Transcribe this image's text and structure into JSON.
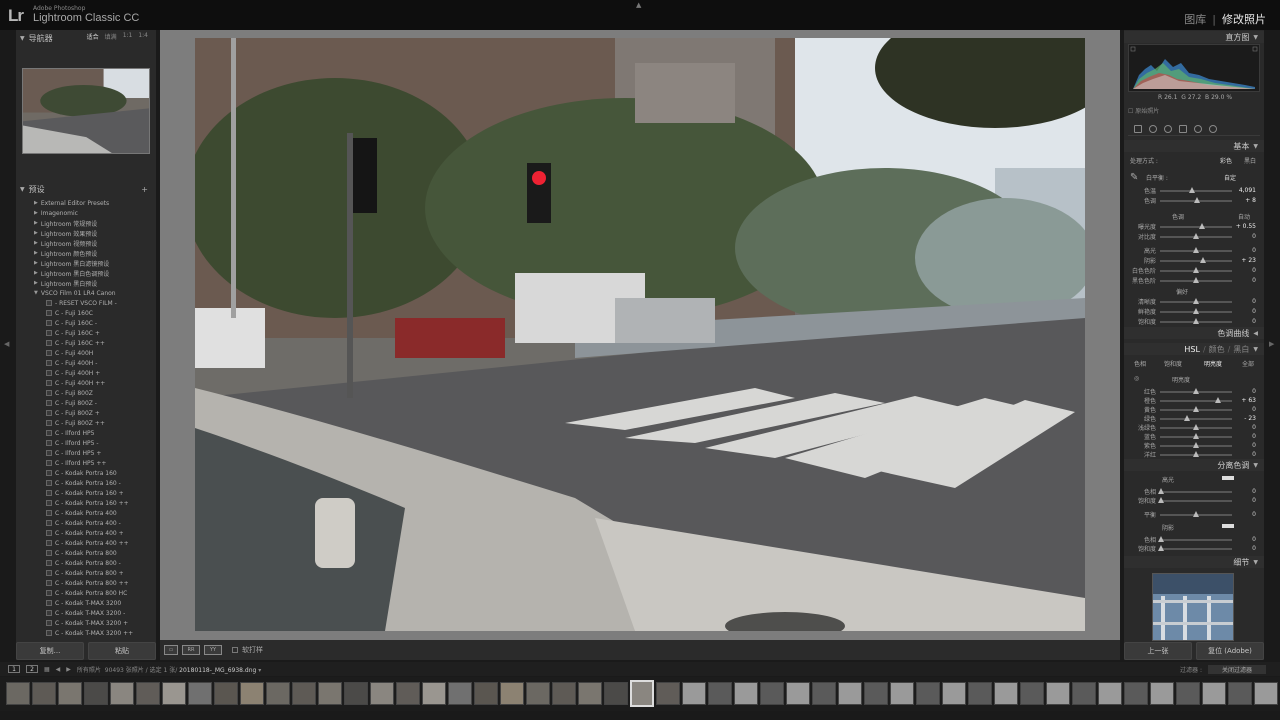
{
  "app": {
    "logo": "Lr",
    "brand_small": "Adobe Photoshop",
    "brand": "Lightroom Classic CC",
    "modules": [
      "图库",
      "修改照片"
    ],
    "active_module": "修改照片"
  },
  "left": {
    "navigator": {
      "title": "导航器",
      "zoom": [
        "适合",
        "填满",
        "1:1",
        "1:4"
      ]
    },
    "presets": {
      "title": "预设",
      "add": "+",
      "folders": [
        "External Editor Presets",
        "Imagenomic",
        "Lightroom 常规预设",
        "Lightroom 效果预设",
        "Lightroom 视频预设",
        "Lightroom 颜色预设",
        "Lightroom 黑白滤镜预设",
        "Lightroom 黑白色调预设",
        "Lightroom 黑白预设"
      ],
      "open_folder": "VSCO Film 01 LR4 Canon",
      "items": [
        "- RESET VSCO FILM -",
        "C - Fuji 160C",
        "C - Fuji 160C -",
        "C - Fuji 160C +",
        "C - Fuji 160C ++",
        "C - Fuji 400H",
        "C - Fuji 400H -",
        "C - Fuji 400H +",
        "C - Fuji 400H ++",
        "C - Fuji 800Z",
        "C - Fuji 800Z -",
        "C - Fuji 800Z +",
        "C - Fuji 800Z ++",
        "C - Ilford HP5",
        "C - Ilford HP5 -",
        "C - Ilford HP5 +",
        "C - Ilford HP5 ++",
        "C - Kodak Portra 160",
        "C - Kodak Portra 160 -",
        "C - Kodak Portra 160 +",
        "C - Kodak Portra 160 ++",
        "C - Kodak Portra 400",
        "C - Kodak Portra 400 -",
        "C - Kodak Portra 400 +",
        "C - Kodak Portra 400 ++",
        "C - Kodak Portra 800",
        "C - Kodak Portra 800 -",
        "C - Kodak Portra 800 +",
        "C - Kodak Portra 800 ++",
        "C - Kodak Portra 800 HC",
        "C - Kodak T-MAX 3200",
        "C - Kodak T-MAX 3200 -",
        "C - Kodak T-MAX 3200 +",
        "C - Kodak T-MAX 3200 ++"
      ]
    },
    "copy_label": "复制...",
    "paste_label": "粘贴"
  },
  "toolbar": {
    "softproof": "软打样"
  },
  "filmstrip": {
    "pages": [
      "1",
      "2"
    ],
    "source": "所有照片",
    "count": "90493 张照片 / 选定 1 张/",
    "file": "20180118-_MG_6938.dng",
    "filter_label": "过滤器 :",
    "filter_value": "关闭过滤器"
  },
  "right": {
    "histogram": {
      "title": "直方图",
      "r_label": "R",
      "r": "26.1",
      "g_label": "G",
      "g": "27.2",
      "b_label": "B",
      "b": "29.0",
      "unit": "%"
    },
    "original_photo": "原始照片",
    "basic": {
      "title": "基本",
      "treatment": "处理方式 :",
      "color": "彩色",
      "bw": "黑白",
      "wb": "白平衡 :",
      "wb_value": "自定",
      "temp": {
        "label": "色温",
        "value": "4,091"
      },
      "tint": {
        "label": "色调",
        "value": "+ 8"
      },
      "tone": "色调",
      "auto": "自动",
      "exposure": {
        "label": "曝光度",
        "value": "+ 0.55"
      },
      "contrast": {
        "label": "对比度",
        "value": "0"
      },
      "highlights": {
        "label": "高光",
        "value": "0"
      },
      "shadows": {
        "label": "阴影",
        "value": "+ 23"
      },
      "whites": {
        "label": "白色色阶",
        "value": "0"
      },
      "blacks": {
        "label": "黑色色阶",
        "value": "0"
      },
      "presence": "偏好",
      "clarity": {
        "label": "清晰度",
        "value": "0"
      },
      "vibrance": {
        "label": "鲜艳度",
        "value": "0"
      },
      "saturation": {
        "label": "饱和度",
        "value": "0"
      }
    },
    "tone_curve": {
      "title": "色调曲线"
    },
    "hsl": {
      "tabs": [
        "HSL",
        "颜色",
        "黑白"
      ],
      "subtabs": [
        "色相",
        "饱和度",
        "明亮度",
        "全部"
      ],
      "section": "明亮度",
      "rows": [
        {
          "label": "红色",
          "value": "0"
        },
        {
          "label": "橙色",
          "value": "+ 63"
        },
        {
          "label": "黄色",
          "value": "0"
        },
        {
          "label": "绿色",
          "value": "- 23"
        },
        {
          "label": "浅绿色",
          "value": "0"
        },
        {
          "label": "蓝色",
          "value": "0"
        },
        {
          "label": "紫色",
          "value": "0"
        },
        {
          "label": "洋红",
          "value": "0"
        }
      ]
    },
    "split": {
      "title": "分离色调",
      "highlights": "高光",
      "hue": {
        "label": "色相",
        "value": "0"
      },
      "sat": {
        "label": "饱和度",
        "value": "0"
      },
      "balance": {
        "label": "平衡",
        "value": "0"
      },
      "shadows": "阴影",
      "hue2": {
        "label": "色相",
        "value": "0"
      },
      "sat2": {
        "label": "饱和度",
        "value": "0"
      }
    },
    "detail": {
      "title": "细节"
    },
    "prev_label": "上一张",
    "reset_label": "复位 (Adobe)"
  }
}
